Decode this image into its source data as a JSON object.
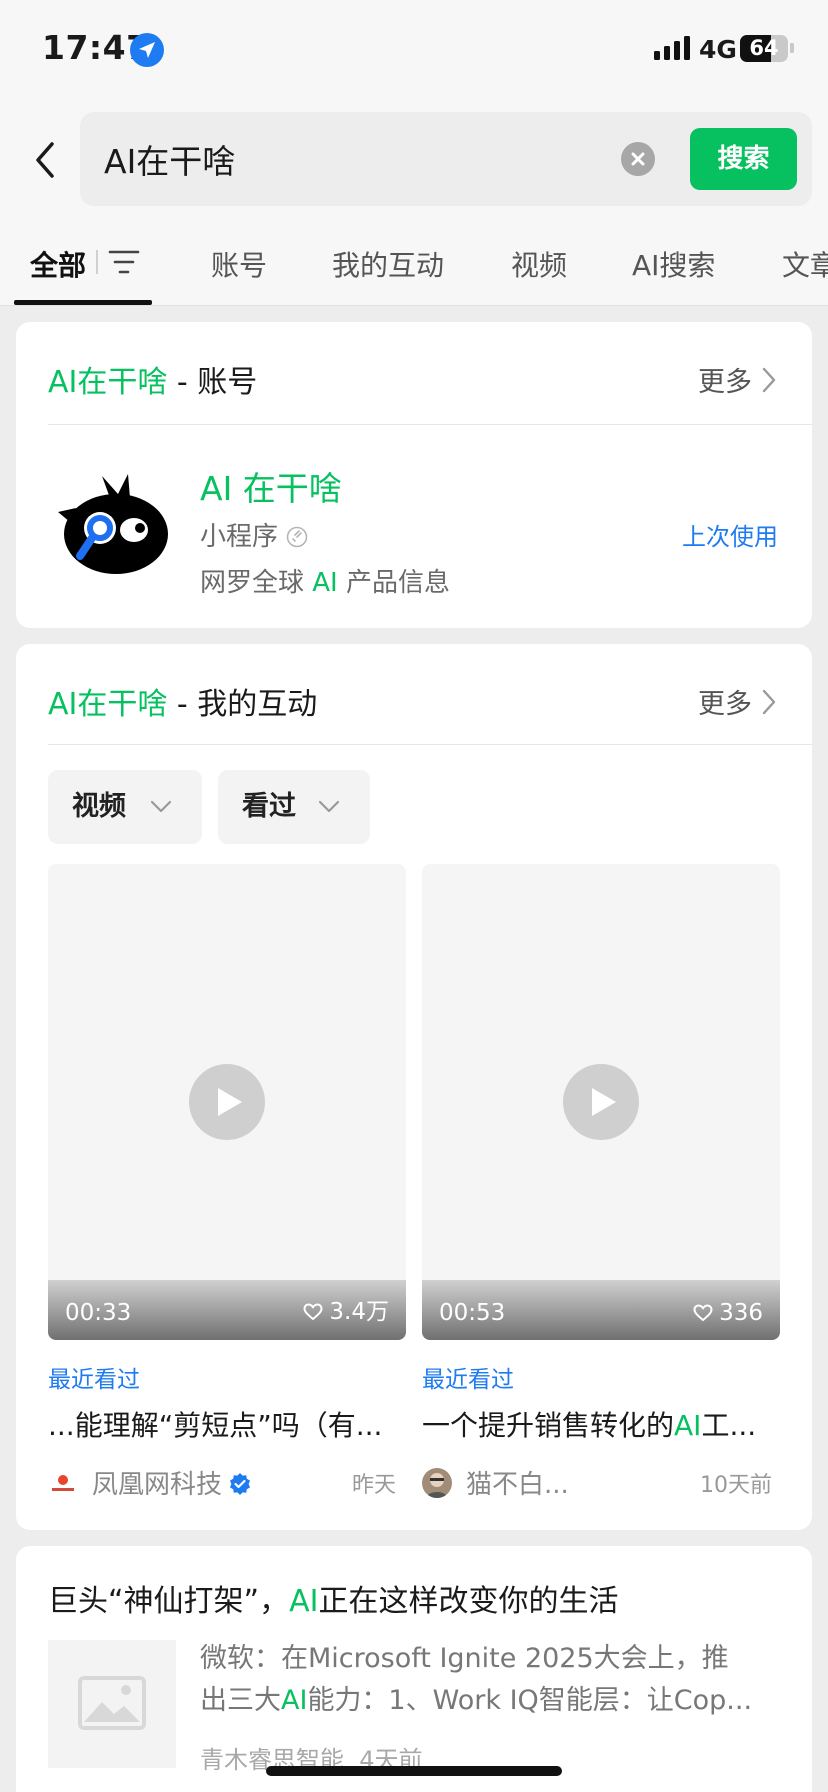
{
  "status_bar": {
    "time": "17:47",
    "network": "4G",
    "battery": "64",
    "battery_level": 0.64
  },
  "search": {
    "query": "AI在干啥",
    "button_label": "搜索"
  },
  "tabs": [
    {
      "label": "全部",
      "active": true
    },
    {
      "label": "账号"
    },
    {
      "label": "我的互动"
    },
    {
      "label": "视频"
    },
    {
      "label": "AI搜索"
    },
    {
      "label": "文章"
    }
  ],
  "account_section": {
    "title_keyword": "AI在干啥",
    "title_suffix": " - 账号",
    "more_label": "更多",
    "miniprogram": {
      "name": "AI 在干啥",
      "type": "小程序",
      "desc_prefix": "网罗全球 ",
      "desc_keyword": "AI",
      "desc_suffix": " 产品信息",
      "recent_label": "上次使用"
    }
  },
  "interaction_section": {
    "title_keyword": "AI在干啥",
    "title_suffix": " - 我的互动",
    "more_label": "更多",
    "filters": [
      {
        "label": "视频"
      },
      {
        "label": "看过"
      }
    ],
    "videos": [
      {
        "duration": "00:33",
        "likes": "3.4万",
        "watched_label": "最近看过",
        "title_before": "...能理解“剪短点”吗（有...",
        "title_keyword": "",
        "title_after": "",
        "author": "凤凰网科技",
        "verified": true,
        "time_ago": "昨天"
      },
      {
        "duration": "00:53",
        "likes": "336",
        "watched_label": "最近看过",
        "title_before": "一个提升销售转化的",
        "title_keyword": "AI",
        "title_after": "工...",
        "author": "猫不白...",
        "verified": false,
        "time_ago": "10天前"
      }
    ]
  },
  "article": {
    "title_before": "巨头“神仙打架”，",
    "title_keyword": "AI",
    "title_after": "正在这样改变你的生活",
    "snippet_line1": "微软：在Microsoft Ignite 2025大会上，推",
    "snippet_line2_before": "出三大",
    "snippet_line2_keyword": "AI",
    "snippet_line2_after": "能力：1、Work IQ智能层：让Cop...",
    "source": "青木睿思智能",
    "time_ago": "4天前"
  },
  "colors": {
    "accent_green": "#07c160",
    "link_blue": "#1e7bf2",
    "background": "#ededed"
  }
}
